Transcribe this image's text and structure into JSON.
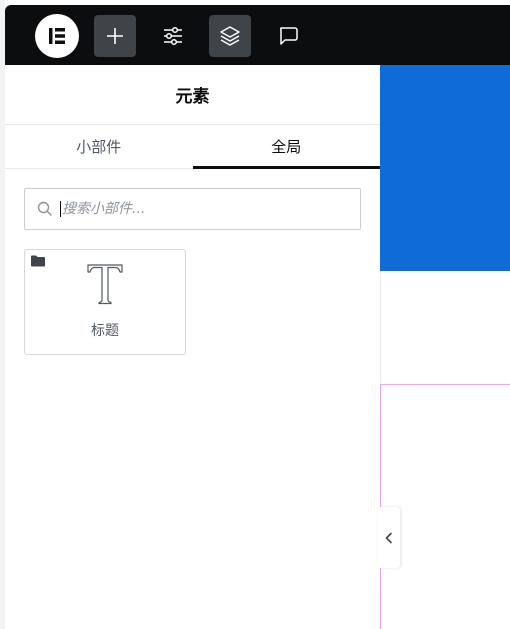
{
  "toolbar": {
    "logo": "elementor-logo",
    "buttons": [
      {
        "name": "add-element",
        "icon": "plus-icon",
        "active": true
      },
      {
        "name": "site-settings",
        "icon": "sliders-icon",
        "active": false
      },
      {
        "name": "structure",
        "icon": "layers-icon",
        "active": true
      },
      {
        "name": "comments",
        "icon": "comment-icon",
        "active": false
      }
    ]
  },
  "panel": {
    "title": "元素",
    "tabs": [
      {
        "label": "小部件",
        "active": false
      },
      {
        "label": "全局",
        "active": true
      }
    ],
    "search": {
      "placeholder": "搜索小部件...",
      "value": ""
    },
    "widgets": [
      {
        "label": "标题",
        "icon": "heading-icon",
        "badge": "folder-icon"
      }
    ]
  },
  "preview": {
    "hero_color": "#0e6bd7",
    "frame_color": "#e8a4f0"
  },
  "colors": {
    "toolbar_bg": "#0c0d0e",
    "active_button_bg": "#3f4448",
    "active_tab_indicator": "#0c0d0e"
  }
}
